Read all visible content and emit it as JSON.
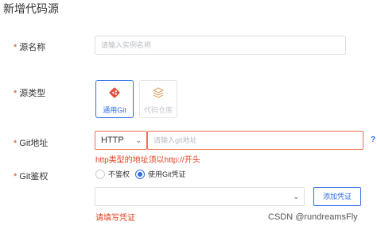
{
  "dialog": {
    "title": "新增代码源"
  },
  "form": {
    "source_name": {
      "label": "源名称",
      "placeholder": "请输入实例名称"
    },
    "source_type": {
      "label": "源类型",
      "options": [
        {
          "label": "通用Git",
          "icon": "git-icon",
          "selected": true
        },
        {
          "label": "代码仓库",
          "icon": "layers-icon",
          "selected": false
        }
      ]
    },
    "git_url": {
      "label": "Git地址",
      "protocol": "HTTP",
      "placeholder": "请输入git地址",
      "help_icon": "?",
      "error": "http类型的地址须以http://开头"
    },
    "git_auth": {
      "label": "Git鉴权",
      "options": [
        {
          "label": "不鉴权",
          "selected": false
        },
        {
          "label": "使用Git凭证",
          "selected": true
        }
      ],
      "credential_value": "",
      "add_button": "添加凭证",
      "error": "请填写凭证"
    }
  },
  "watermark": "CSDN @rundreamsFly",
  "colors": {
    "primary": "#2f6fe0",
    "error": "#e0421f",
    "git": "#e24f3a"
  }
}
